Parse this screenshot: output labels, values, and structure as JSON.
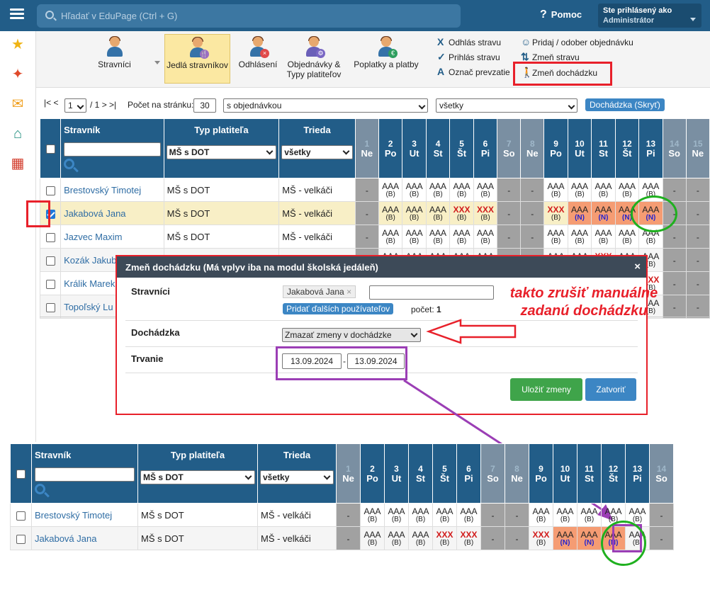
{
  "topbar": {
    "search_placeholder": "Hľadať v EduPage (Ctrl + G)",
    "help": "Pomoc",
    "user_line1": "Ste prihlásený ako",
    "user_line2": "Administrátor"
  },
  "toolbar": {
    "buttons": [
      "Stravníci",
      "Jedlá stravníkov",
      "Odhlásení",
      "Objednávky &",
      "Typy platiteľov",
      "Poplatky a platby"
    ],
    "menu": [
      "Odhlás stravu",
      "Prihlás stravu",
      "Označ prevzatie",
      "Pridaj / odober objednávku",
      "Zmeň stravu",
      "Zmeň dochádzku"
    ]
  },
  "pager": {
    "first": "|<",
    "prev": "<",
    "page": "1",
    "of": "/ 1",
    "next": ">",
    "last": ">|",
    "per_page_label": "Počet na stránku:",
    "per_page": "30",
    "filter1": "s objednávkou",
    "filter2": "všetky",
    "attendance_btn": "Dochádzka (Skryť)"
  },
  "table": {
    "col_name": "Stravník",
    "col_type": "Typ platiteľa",
    "col_class": "Trieda",
    "type_filter": "MŠ s DOT",
    "class_filter": "všetky",
    "days": [
      [
        "1",
        "Ne"
      ],
      [
        "2",
        "Po"
      ],
      [
        "3",
        "Ut"
      ],
      [
        "4",
        "St"
      ],
      [
        "5",
        "Št"
      ],
      [
        "6",
        "Pi"
      ],
      [
        "7",
        "So"
      ],
      [
        "8",
        "Ne"
      ],
      [
        "9",
        "Po"
      ],
      [
        "10",
        "Ut"
      ],
      [
        "11",
        "St"
      ],
      [
        "12",
        "Št"
      ],
      [
        "13",
        "Pi"
      ],
      [
        "14",
        "So"
      ],
      [
        "15",
        "Ne"
      ]
    ],
    "rows": [
      {
        "name": "Brestovský Timotej",
        "type": "MŠ s DOT",
        "class": "MŠ - velkáči"
      },
      {
        "name": "Jakabová Jana",
        "type": "MŠ s DOT",
        "class": "MŠ - velkáči"
      },
      {
        "name": "Jazvec Maxim",
        "type": "MŠ s DOT",
        "class": "MŠ - velkáči"
      },
      {
        "name": "Kozák Jakub",
        "type": "",
        "class": ""
      },
      {
        "name": "Králik Marek",
        "type": "",
        "class": ""
      },
      {
        "name": "Topoľský Lu",
        "type": "",
        "class": ""
      }
    ],
    "aaa": "AAA",
    "xxx": "XXX",
    "b": "(B)",
    "n": "(N)",
    "dash": "-"
  },
  "modal": {
    "title": "Zmeň dochádzku (Má vplyv iba na modul školská jedáleň)",
    "close": "×",
    "label_users": "Stravníci",
    "user_tag": "Jakabová Jana",
    "add_users": "Pridať ďalších používateľov",
    "count_label": "počet:",
    "count": "1",
    "label_att": "Dochádzka",
    "att_value": "Zmazať zmeny v dochádzke",
    "label_dur": "Trvanie",
    "date_from": "13.09.2024",
    "date_sep": "-",
    "date_to": "13.09.2024",
    "save": "Uložiť zmeny",
    "close_btn": "Zatvoriť"
  },
  "annotation": {
    "line1": "takto zrušiť manuálne",
    "line2": "zadanú dochádzku"
  },
  "colors": {
    "header": "#225d88",
    "accent_red": "#e8202a",
    "purple": "#9b3eb5",
    "green": "#1fb01f"
  }
}
